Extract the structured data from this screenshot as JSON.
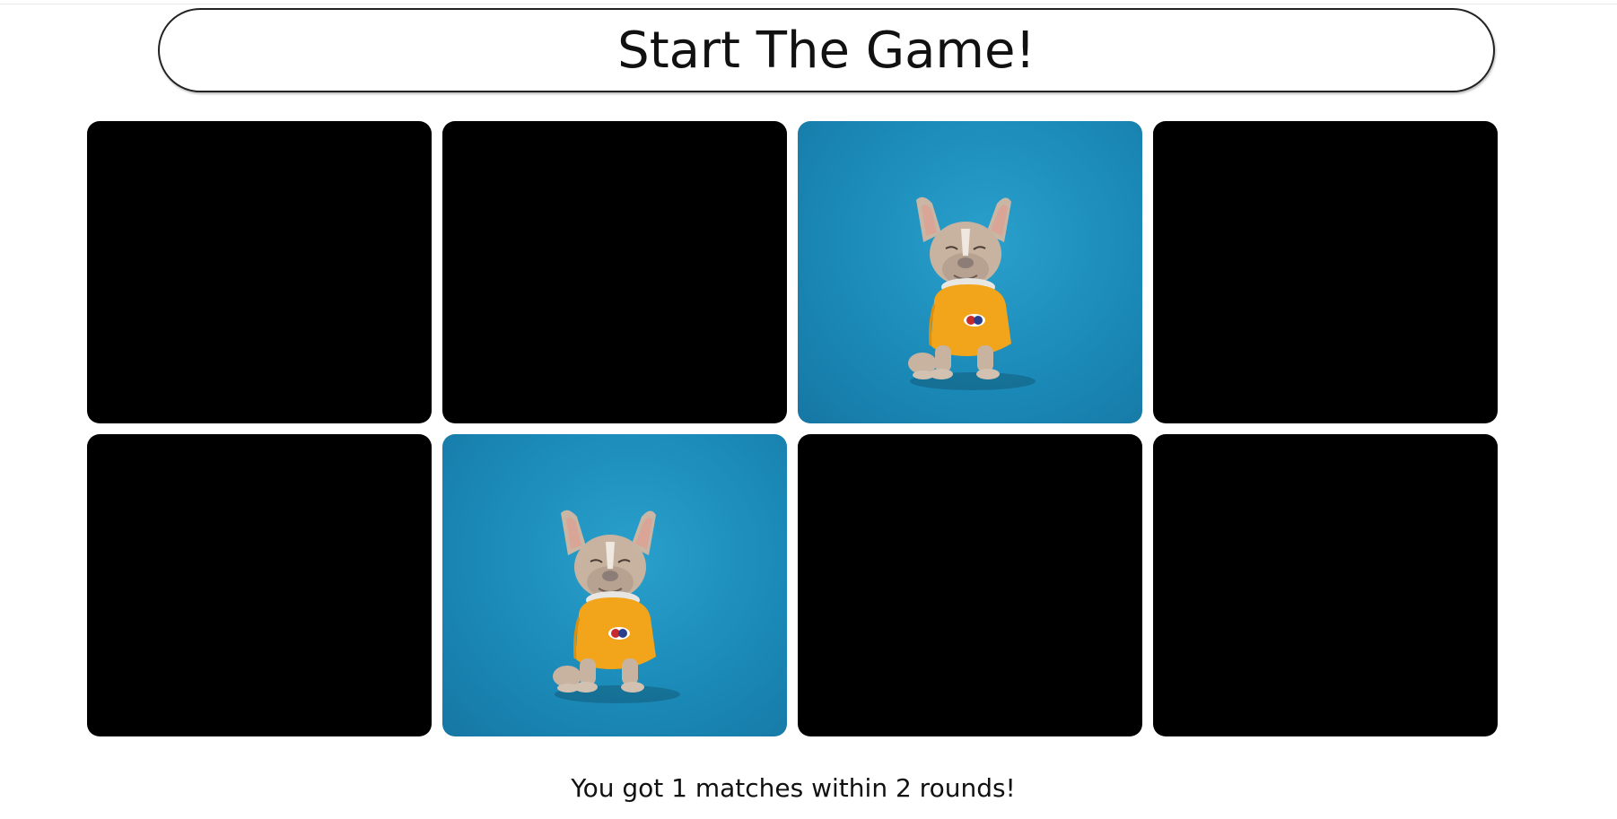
{
  "header": {
    "start_label": "Start The Game!"
  },
  "board": {
    "rows": 2,
    "columns": 4,
    "cards": [
      {
        "state": "face-down"
      },
      {
        "state": "face-down"
      },
      {
        "state": "face-up",
        "image": "french-bulldog-yellow-shirt"
      },
      {
        "state": "face-down"
      },
      {
        "state": "face-down"
      },
      {
        "state": "face-up",
        "image": "french-bulldog-yellow-shirt"
      },
      {
        "state": "face-down"
      },
      {
        "state": "face-down"
      }
    ],
    "colors": {
      "card_back": "#000000",
      "photo_background": "#1b8ab8",
      "shirt": "#f2a41a"
    }
  },
  "status": {
    "message": "You got 1 matches within 2 rounds!"
  }
}
